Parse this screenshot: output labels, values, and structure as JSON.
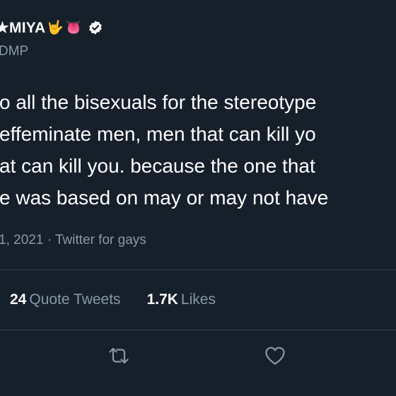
{
  "tweet": {
    "display_name": "★MIYA",
    "emoji_1": "🤟",
    "emoji_2": "👅",
    "handle": "DMP",
    "body_lines": [
      "o all the bisexuals for the stereotype",
      "effeminate men, men that can kill yo",
      "at can kill you. because the one that",
      "e was based on may or may not have"
    ],
    "date": "1, 2021",
    "separator": "·",
    "source": "Twitter for gays"
  },
  "stats": {
    "quote_count": "24",
    "quote_label": "Quote Tweets",
    "like_count": "1.7K",
    "like_label": "Likes"
  },
  "actions": {
    "retweet_icon": "retweet-icon",
    "like_icon": "heart-icon"
  },
  "colors": {
    "background": "#15202b",
    "primary_text": "#ffffff",
    "secondary_text": "#8899a6",
    "divider": "#38444d"
  }
}
